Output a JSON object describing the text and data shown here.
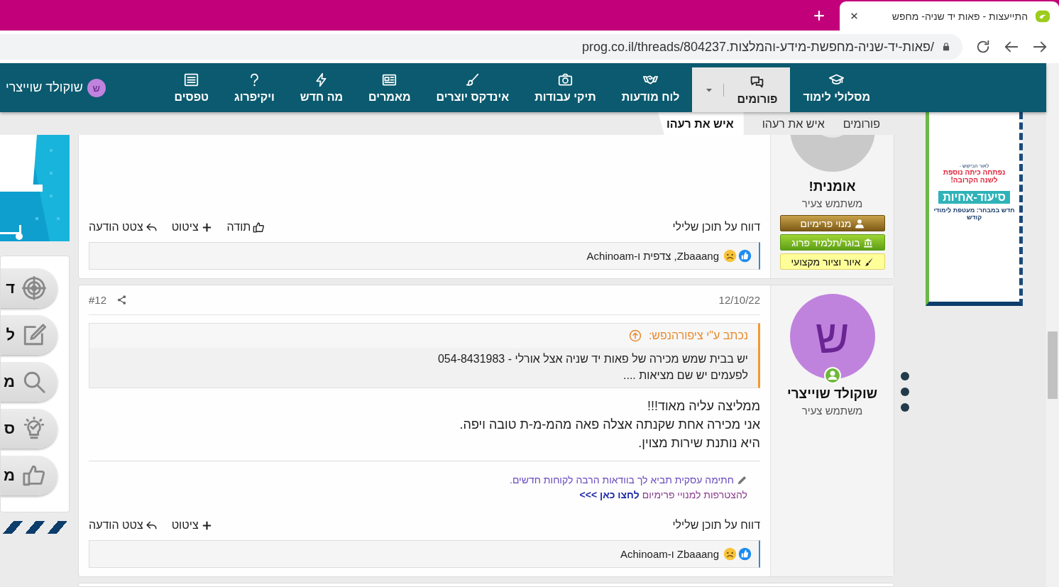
{
  "browser": {
    "tab_title": "התייעצות - פאות יד שניה- מחפש",
    "url": "prog.co.il/threads/804237.פאות-יד-שניה-מחפשת-מידע-והמלצות/"
  },
  "nav": {
    "items": [
      {
        "label": "מסלולי לימוד",
        "selected": false,
        "dropdown": false
      },
      {
        "label": "פורומים",
        "selected": true,
        "dropdown": true
      },
      {
        "label": "לוח מודעות",
        "selected": false,
        "dropdown": false
      },
      {
        "label": "תיקי עבודות",
        "selected": false,
        "dropdown": false
      },
      {
        "label": "אינדקס יוצרים",
        "selected": false,
        "dropdown": false
      },
      {
        "label": "מאמרים",
        "selected": false,
        "dropdown": false
      },
      {
        "label": "מה חדש",
        "selected": false,
        "dropdown": false
      },
      {
        "label": "ויקיפרוג",
        "selected": false,
        "dropdown": false
      },
      {
        "label": "טפסים",
        "selected": false,
        "dropdown": false
      }
    ],
    "user": {
      "initial": "ש",
      "name": "שוקולד שוייצרי"
    }
  },
  "breadcrumbs": [
    {
      "label": "פורומים",
      "selected": false
    },
    {
      "label": "איש את רעהו",
      "selected": false
    },
    {
      "label": "איש את רעהו",
      "selected": true
    }
  ],
  "side_tools": [
    {
      "label": "ד"
    },
    {
      "label": "ל"
    },
    {
      "label": "מ"
    },
    {
      "label": "ס"
    },
    {
      "label": "מ"
    }
  ],
  "ad": {
    "lines": [
      {
        "kind": "small",
        "text": "לאור הביקוש -"
      },
      {
        "kind": "alert",
        "text": "נפתחה כיתה נוספת"
      },
      {
        "kind": "alert",
        "text": "לשנה הקרובה!"
      },
      {
        "kind": "headline",
        "text": "סיעוד-אחיות"
      },
      {
        "kind": "footer",
        "text": "חדש במבחר: מעטפת לימודי קודש"
      }
    ]
  },
  "posts": [
    {
      "user": {
        "avatar": {
          "kind": "default"
        },
        "online": false,
        "name": "אומנית!",
        "title": "משתמש צעיר",
        "badges": [
          {
            "kind": "premium",
            "label": "מנוי פרימיום"
          },
          {
            "kind": "graduate",
            "label": "בוגר/תלמיד פרוג"
          },
          {
            "kind": "art",
            "label": "איור וציור מקצועי"
          }
        ]
      },
      "report": "דווח על תוכן שלילי",
      "actions": [
        {
          "kind": "thanks",
          "label": "תודה"
        },
        {
          "kind": "quote",
          "label": "ציטוט"
        },
        {
          "kind": "reply",
          "label": "צטט הודעה"
        }
      ],
      "reactions": {
        "text": "Zbaaang, צדפית ו-Achinoam"
      }
    },
    {
      "user": {
        "avatar": {
          "kind": "letter",
          "letter": "ש",
          "color": "#c083dd"
        },
        "online": true,
        "name": "שוקולד שוייצרי",
        "title": "משתמש צעיר"
      },
      "date": "12/10/22",
      "number": "#12",
      "quote": {
        "author": "נכתב ע\"י ציפורהנפש:",
        "lines": [
          "יש בבית שמש מכירה של פאות יד שניה אצל אורלי - 054-8431983",
          "לפעמים יש שם מציאות ...."
        ]
      },
      "body": [
        "ממליצה עליה מאוד!!!",
        "אני מכירה אחת שקנתה אצלה פאה מהמ-מ-ת טובה ויפה.",
        "היא נותנת שירות מצוין."
      ],
      "signature": {
        "line": "חתימה עסקית תביא לך בוודאות הרבה לקוחות חדשים.",
        "join": "להצטרפות למנויי פרימיום",
        "link": "לחצו כאן >>>"
      },
      "report": "דווח על תוכן שלילי",
      "actions": [
        {
          "kind": "quote",
          "label": "ציטוט"
        },
        {
          "kind": "reply",
          "label": "צטט הודעה"
        }
      ],
      "reactions": {
        "text": "Zbaaang ו-Achinoam"
      }
    }
  ]
}
